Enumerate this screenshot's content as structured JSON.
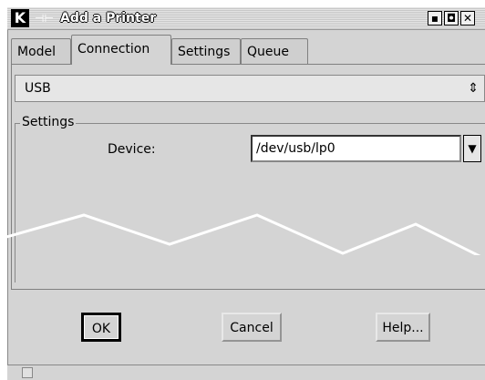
{
  "window": {
    "title": "Add a Printer",
    "app_icon": "K",
    "pin_glyph": "⊣⊢",
    "buttons": [
      "▪",
      "◘",
      "✕"
    ]
  },
  "tabs": [
    {
      "label": "Model",
      "active": false
    },
    {
      "label": "Connection",
      "active": true
    },
    {
      "label": "Settings",
      "active": false
    },
    {
      "label": "Queue",
      "active": false
    }
  ],
  "connection": {
    "type_value": "USB",
    "type_arrows": "⇕",
    "group_title": "Settings",
    "device_label": "Device:",
    "device_value": "/dev/usb/lp0",
    "dropdown_glyph": "▼"
  },
  "buttons": {
    "ok": "OK",
    "cancel": "Cancel",
    "help": "Help..."
  },
  "colors": {
    "window_bg": "#d4d4d4",
    "accent": "#000000"
  }
}
